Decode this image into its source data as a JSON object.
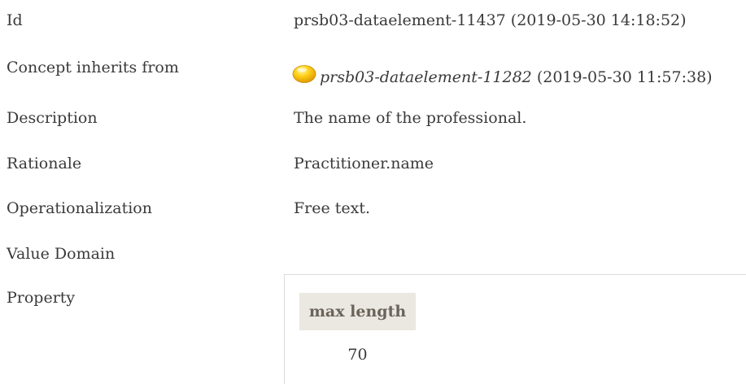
{
  "rows": {
    "id": {
      "label": "Id",
      "value": "prsb03-dataelement-11437 (2019-05-30 14:18:52)"
    },
    "inherits": {
      "label": "Concept inherits from",
      "link": "prsb03-dataelement-11282",
      "suffix": " (2019-05-30 11:57:38)",
      "icon": "status-orb-icon",
      "icon_color": "#f2c200"
    },
    "description": {
      "label": "Description",
      "value": "The name of the professional."
    },
    "rationale": {
      "label": "Rationale",
      "value": "Practitioner.name"
    },
    "operationalization": {
      "label": "Operationalization",
      "value": "Free text."
    },
    "value_domain": {
      "label": "Value Domain"
    },
    "property": {
      "label": "Property",
      "header": "max length",
      "value": "70"
    }
  }
}
